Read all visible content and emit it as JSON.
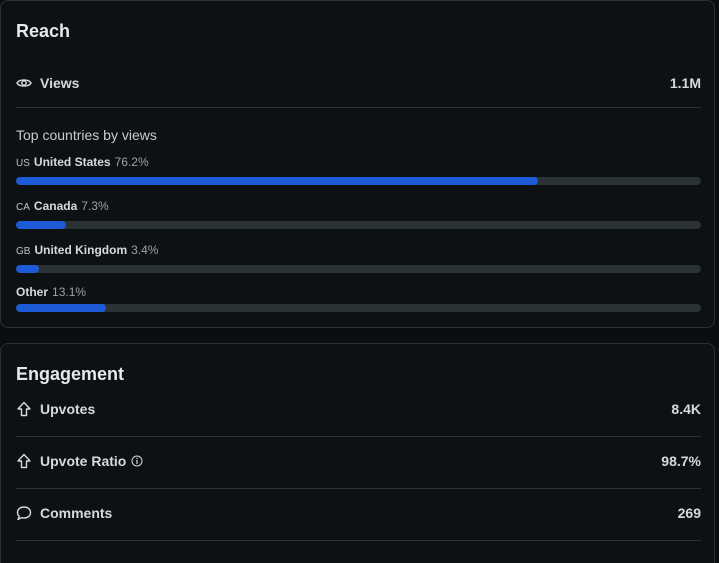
{
  "reach": {
    "title": "Reach",
    "views_label": "Views",
    "views_value": "1.1M",
    "countries_heading": "Top countries by views",
    "countries": [
      {
        "code": "US",
        "name": "United States",
        "pct_label": "76.2%",
        "share": 0.762
      },
      {
        "code": "CA",
        "name": "Canada",
        "pct_label": "7.3%",
        "share": 0.073
      },
      {
        "code": "GB",
        "name": "United Kingdom",
        "pct_label": "3.4%",
        "share": 0.034
      },
      {
        "code": "",
        "name": "Other",
        "pct_label": "13.1%",
        "share": 0.131
      }
    ]
  },
  "engagement": {
    "title": "Engagement",
    "upvotes_label": "Upvotes",
    "upvotes_value": "8.4K",
    "ratio_label": "Upvote Ratio",
    "ratio_value": "98.7%",
    "comments_label": "Comments",
    "comments_value": "269"
  },
  "colors": {
    "bar_fill": "#1d5bd6",
    "bar_track": "#2a3236"
  }
}
